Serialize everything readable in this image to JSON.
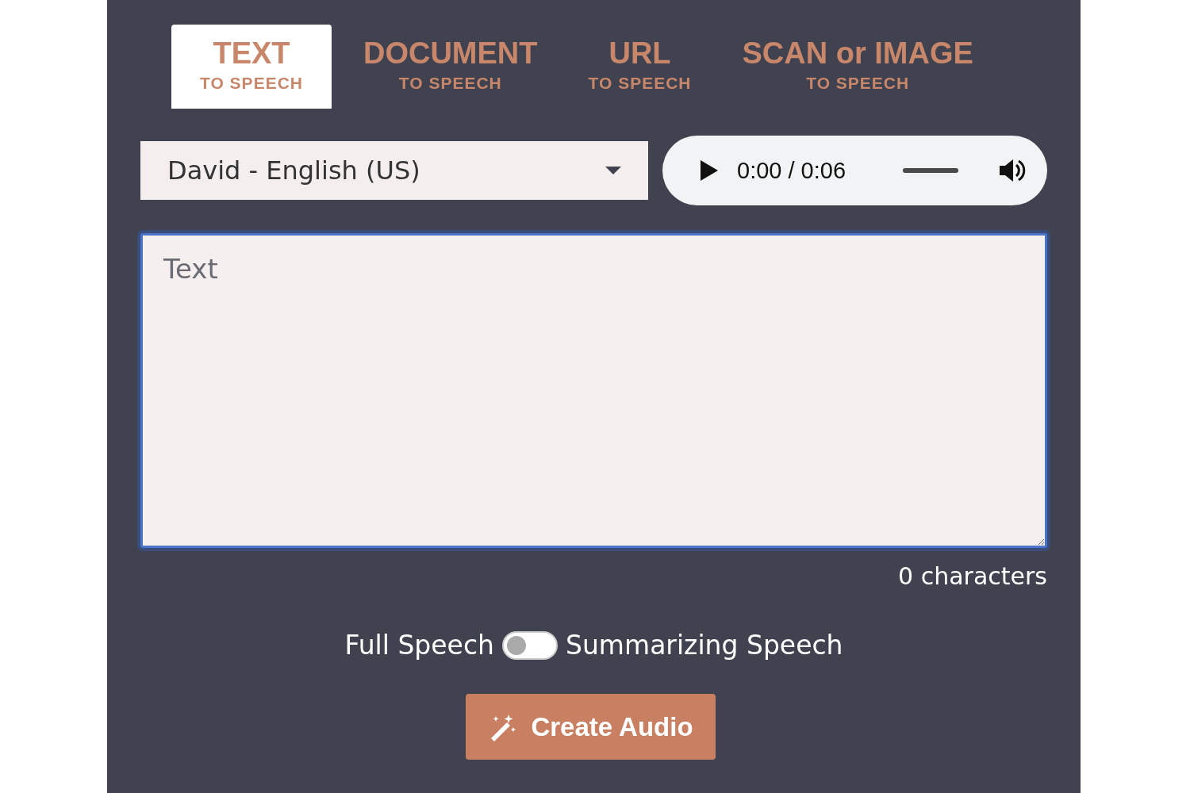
{
  "tabs": [
    {
      "title": "TEXT",
      "subtitle": "TO SPEECH",
      "selected": true
    },
    {
      "title": "DOCUMENT",
      "subtitle": "TO SPEECH",
      "selected": false
    },
    {
      "title": "URL",
      "subtitle": "TO SPEECH",
      "selected": false
    },
    {
      "title": "SCAN or IMAGE",
      "subtitle": "TO SPEECH",
      "selected": false
    }
  ],
  "voice_select": {
    "value": "David - English (US)"
  },
  "audio_player": {
    "time": "0:00 / 0:06",
    "level": 1
  },
  "text_area": {
    "placeholder": "Text"
  },
  "character_count": "0 characters",
  "speech_toggle": {
    "left_label": "Full Speech",
    "right_label": "Summarizing Speech",
    "on": false
  },
  "create_button": {
    "label": "Create Audio"
  }
}
